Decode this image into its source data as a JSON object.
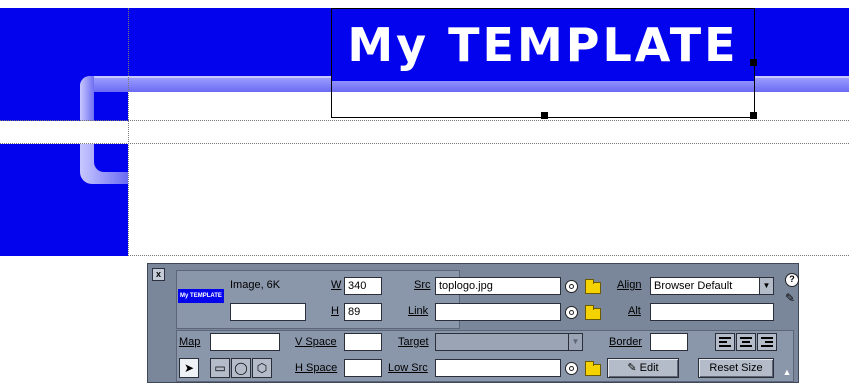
{
  "canvas": {
    "logo_text": "My TEMPLATE",
    "colors": {
      "canvas_blue": "#0303ee",
      "bevel": "#7b7bf8",
      "inspector": "#7a8699"
    }
  },
  "inspector": {
    "close_label": "x",
    "image_thumb_text": "My TEMPLATE",
    "image_info": "Image, 6K",
    "name_value": "",
    "w_label": "W",
    "w_value": "340",
    "h_label": "H",
    "h_value": "89",
    "src_label": "Src",
    "src_value": "toplogo.jpg",
    "link_label": "Link",
    "link_value": "",
    "align_label": "Align",
    "align_value": "Browser Default",
    "alt_label": "Alt",
    "alt_value": "",
    "help_label": "?",
    "map_label": "Map",
    "map_value": "",
    "vspace_label": "V Space",
    "vspace_value": "",
    "hspace_label": "H Space",
    "hspace_value": "",
    "target_label": "Target",
    "target_value": "",
    "lowsrc_label": "Low Src",
    "lowsrc_value": "",
    "border_label": "Border",
    "border_value": "",
    "edit_label": "Edit",
    "reset_size_label": "Reset Size",
    "icons": [
      "point-to-file-icon",
      "folder-icon",
      "help-icon",
      "edit-pencil-icon",
      "arrow-pointer-icon",
      "rect-hotspot-icon",
      "circle-hotspot-icon",
      "polygon-hotspot-icon",
      "align-left-icon",
      "align-center-icon",
      "align-right-icon",
      "expander-arrow-icon"
    ]
  }
}
